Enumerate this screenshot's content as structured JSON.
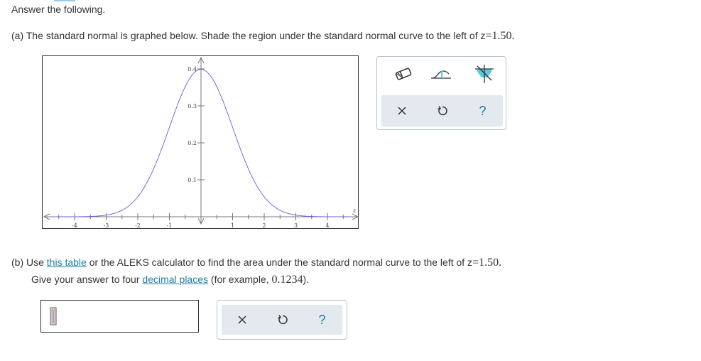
{
  "prompt": "Answer the following.",
  "part_a": {
    "text": "(a) The standard normal is graphed below. Shade the region under the standard normal curve to the left of z",
    "eq": "=",
    "value": "1.50",
    "period": "."
  },
  "graph": {
    "y_ticks": [
      "0.4",
      "0.3",
      "0.2",
      "0.1"
    ],
    "x_ticks": [
      "-4",
      "-3",
      "-2",
      "-1",
      "1",
      "2",
      "3",
      "4"
    ],
    "x_axis_label": "z",
    "curve_color": "#6a5adf"
  },
  "graph_tools": {
    "top_icons": [
      "eraser-icon",
      "region-shade-tool-icon",
      "point-shade-tool-icon"
    ],
    "bottom_icons": [
      "clear-x-icon",
      "undo-icon",
      "help-question-icon"
    ],
    "accent_color": "#5bc9e0"
  },
  "part_b": {
    "prefix": "(b) Use ",
    "link_table": "this table",
    "middle": " or the ALEKS calculator to find the area under the standard normal curve to the left of z",
    "eq": "=",
    "value": "1.50",
    "period": ".",
    "line2_prefix": "Give your answer to four ",
    "link_decimal": "decimal places",
    "line2_mid": " (for example, ",
    "example": "0.1234",
    "line2_end": ")."
  },
  "answer_panel": {
    "icons": [
      "clear-x-icon",
      "undo-icon",
      "help-question-icon"
    ]
  }
}
